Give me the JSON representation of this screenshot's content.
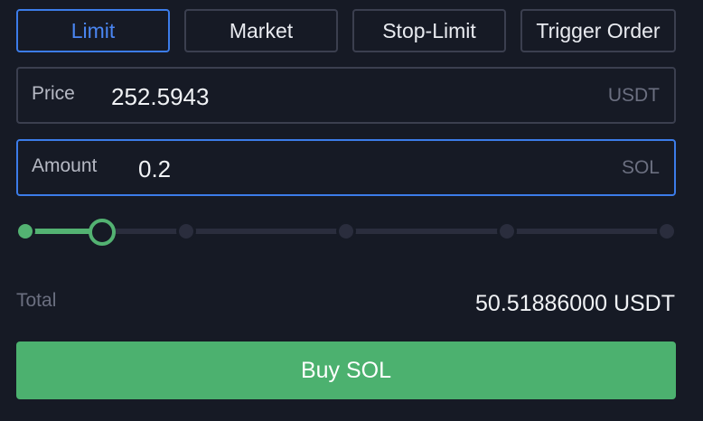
{
  "tabs": [
    {
      "label": "Limit",
      "active": true
    },
    {
      "label": "Market",
      "active": false
    },
    {
      "label": "Stop-Limit",
      "active": false
    },
    {
      "label": "Trigger Order",
      "active": false
    }
  ],
  "price": {
    "label": "Price",
    "value": "252.5943",
    "unit": "USDT"
  },
  "amount": {
    "label": "Amount",
    "value": "0.2",
    "unit": "SOL"
  },
  "slider": {
    "percent": 12,
    "stops": [
      0,
      25,
      50,
      75,
      100
    ]
  },
  "total": {
    "label": "Total",
    "value": "50.51886000 USDT"
  },
  "buy_button": {
    "label": "Buy SOL"
  },
  "colors": {
    "accent_blue": "#3c7ce9",
    "buy_green": "#4cb16f",
    "background": "#161a25",
    "border": "#3b3f4f"
  }
}
